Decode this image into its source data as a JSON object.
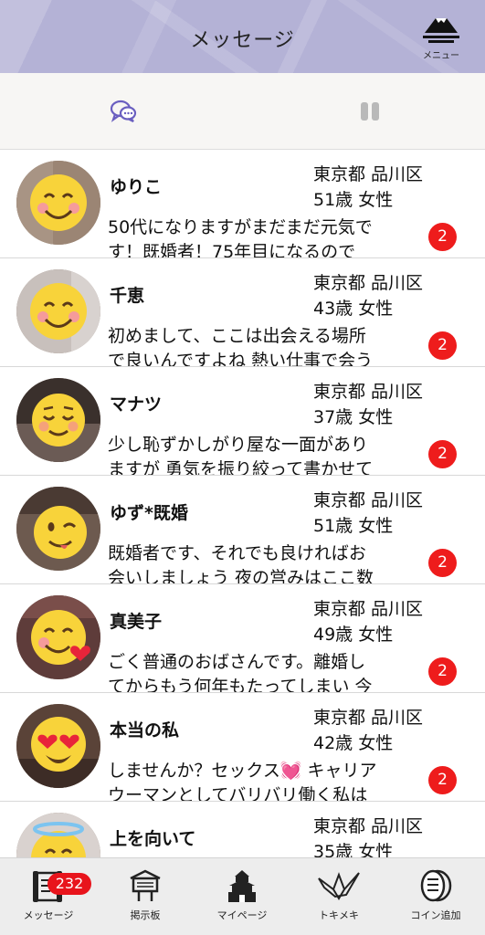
{
  "header": {
    "title": "メッセージ",
    "menu_label": "メニュー",
    "menu_icon": "mount-fuji-icon"
  },
  "tabs": {
    "chat_icon": "chat-bubbles-icon",
    "pause_icon": "pause-icon",
    "active_color": "#6a5fc0"
  },
  "messages": [
    {
      "name": "ゆりこ",
      "location": "東京都 品川区",
      "age_gender": "51歳 女性",
      "preview": "50代になりますがまだまだ元気です！既婚者！75年目になるので",
      "unread": "2",
      "emoji": "smile"
    },
    {
      "name": "千恵",
      "location": "東京都 品川区",
      "age_gender": "43歳 女性",
      "preview": "初めまして、ここは出会える場所で良いんですよね 熱い仕事で会うの",
      "unread": "2",
      "emoji": "smile"
    },
    {
      "name": "マナツ",
      "location": "東京都 品川区",
      "age_gender": "37歳 女性",
      "preview": "少し恥ずかしがり屋な一面がありますが 勇気を振り絞って書かせてま",
      "unread": "2",
      "emoji": "relieved"
    },
    {
      "name": "ゆず*既婚",
      "location": "東京都 品川区",
      "age_gender": "51歳 女性",
      "preview": "既婚者です、それでも良ければお会いしましょう 夜の営みはここ数年",
      "unread": "2",
      "emoji": "wink"
    },
    {
      "name": "真美子",
      "location": "東京都 品川区",
      "age_gender": "49歳 女性",
      "preview": "ごく普通のおばさんです。離婚してからもう何年もたってしまい 今の",
      "unread": "2",
      "emoji": "heart"
    },
    {
      "name": "本当の私",
      "location": "東京都 品川区",
      "age_gender": "42歳 女性",
      "preview": "しませんか？セックス💓 キャリアウーマンとしてバリバリ働く私は寂",
      "unread": "2",
      "emoji": "hearteyes"
    },
    {
      "name": "上を向いて",
      "location": "東京都 品川区",
      "age_gender": "35歳 女性",
      "preview": "",
      "unread": "",
      "emoji": "halo"
    }
  ],
  "bottom_nav": [
    {
      "label": "メッセージ",
      "icon": "scroll-message-icon",
      "badge": "232"
    },
    {
      "label": "掲示板",
      "icon": "board-sign-icon",
      "badge": ""
    },
    {
      "label": "マイページ",
      "icon": "castle-icon",
      "badge": ""
    },
    {
      "label": "トキメキ",
      "icon": "paper-crane-icon",
      "badge": ""
    },
    {
      "label": "コイン追加",
      "icon": "coin-icon",
      "badge": ""
    }
  ]
}
